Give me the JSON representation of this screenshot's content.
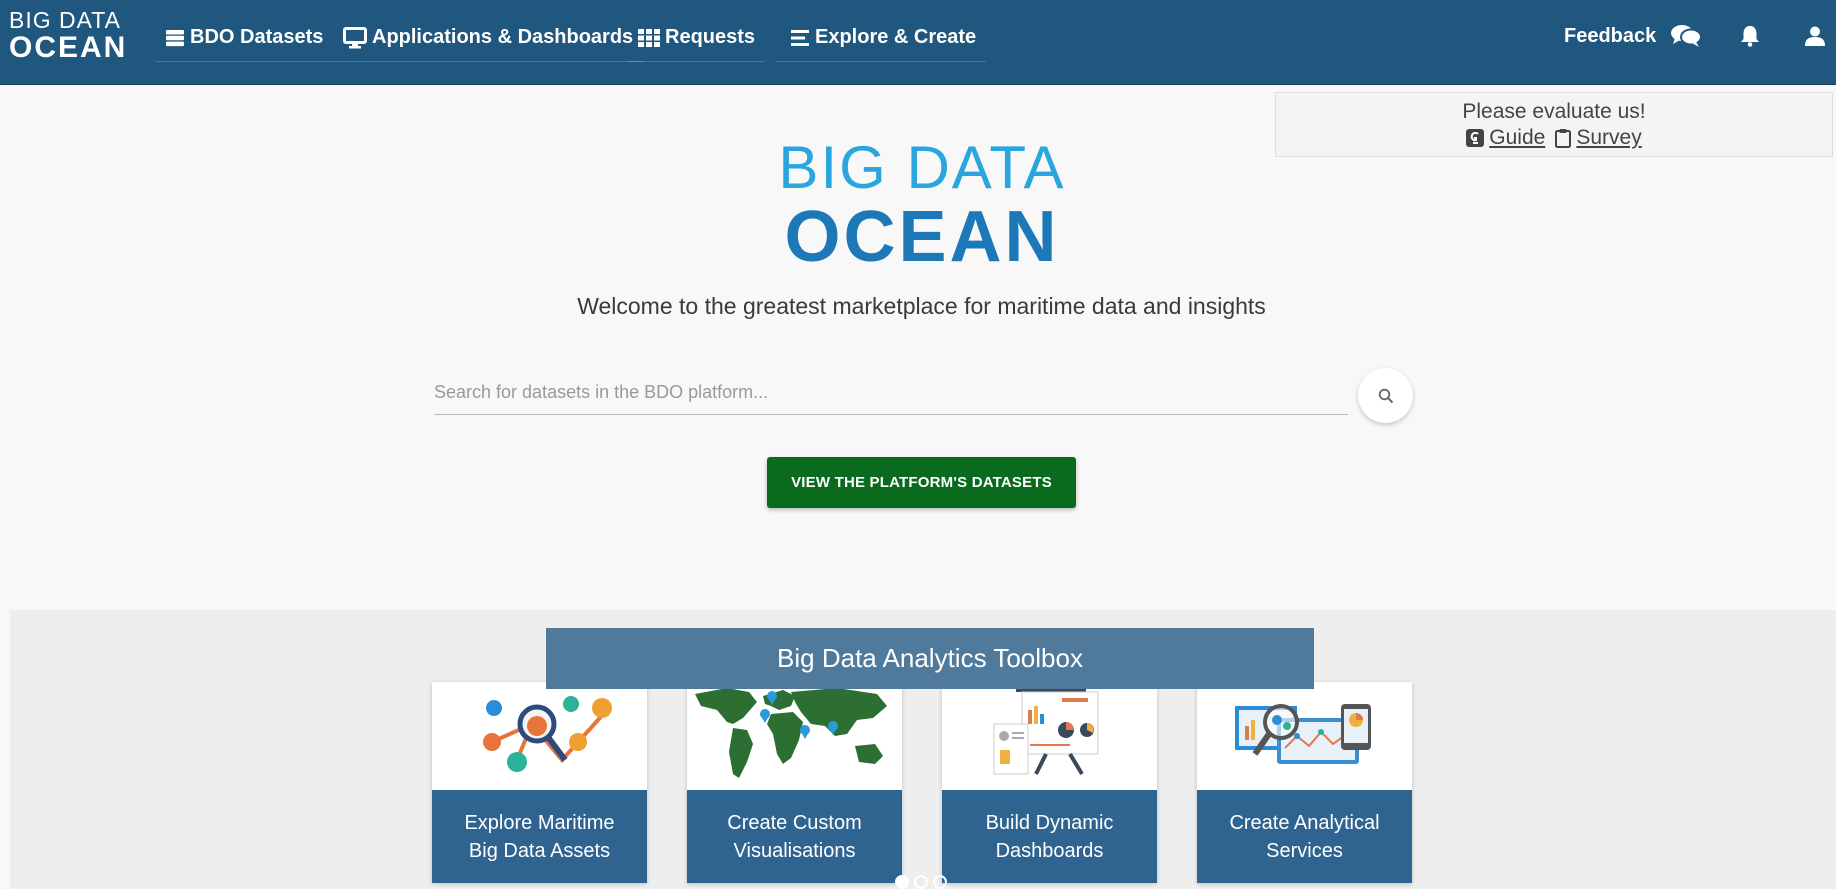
{
  "navbar": {
    "brand_top": "BIG DATA",
    "brand_bottom": "OCEAN",
    "items": [
      {
        "label": "BDO Datasets",
        "icon": "database-icon"
      },
      {
        "label": "Applications & Dashboards",
        "icon": "monitor-icon"
      },
      {
        "label": "Requests",
        "icon": "grid-icon"
      },
      {
        "label": "Explore & Create",
        "icon": "list-icon"
      }
    ],
    "feedback_label": "Feedback",
    "icons": [
      "chat-icon",
      "bell-icon",
      "user-icon"
    ]
  },
  "evaluate": {
    "title": "Please evaluate us!",
    "guide_label": "Guide",
    "survey_label": "Survey"
  },
  "hero": {
    "logo_top": "BIG DATA",
    "logo_bottom": "OCEAN",
    "welcome": "Welcome to the greatest marketplace for maritime data and insights",
    "search_placeholder": "Search for datasets in the BDO platform...",
    "view_button": "VIEW THE PLATFORM'S DATASETS"
  },
  "toolbox": {
    "title": "Big Data Analytics Toolbox",
    "cards": [
      {
        "label": "Explore Maritime Big Data Assets",
        "image": "analytics-illustration"
      },
      {
        "label": "Create Custom Visualisations",
        "image": "world-map-illustration"
      },
      {
        "label": "Build Dynamic Dashboards",
        "image": "presentation-board-illustration"
      },
      {
        "label": "Create Analytical Services",
        "image": "devices-illustration"
      }
    ],
    "carousel_dots": 3,
    "active_dot": 1
  },
  "colors": {
    "navbar": "#20577f",
    "accent_blue": "#2aa6df",
    "logo_dark_blue": "#1d78b8",
    "primary_button": "#0a6a1e",
    "card_label": "#2f6490",
    "toolbox_title": "#4f7a9c"
  }
}
